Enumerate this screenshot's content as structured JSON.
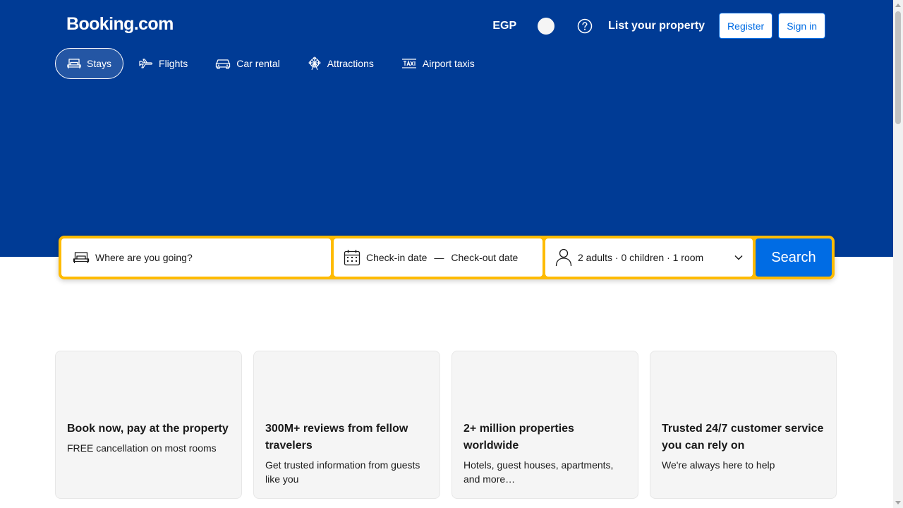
{
  "header": {
    "logo": "Booking.com",
    "currency": "EGP",
    "list_property": "List your property",
    "register": "Register",
    "sign_in": "Sign in"
  },
  "nav": {
    "tabs": [
      {
        "label": "Stays",
        "icon": "bed-icon",
        "active": true
      },
      {
        "label": "Flights",
        "icon": "plane-icon"
      },
      {
        "label": "Car rental",
        "icon": "car-icon"
      },
      {
        "label": "Attractions",
        "icon": "ferris-wheel-icon"
      },
      {
        "label": "Airport taxis",
        "icon": "taxi-icon"
      }
    ]
  },
  "search": {
    "destination_placeholder": "Where are you going?",
    "checkin": "Check-in date",
    "separator": "—",
    "checkout": "Check-out date",
    "guests": "2 adults · 0 children · 1 room",
    "button": "Search"
  },
  "cards": [
    {
      "title": "Book now, pay at the property",
      "text": "FREE cancellation on most rooms"
    },
    {
      "title": "300M+ reviews from fellow travelers",
      "text": "Get trusted information from guests like you"
    },
    {
      "title": "2+ million properties worldwide",
      "text": "Hotels, guest houses, apartments, and more…"
    },
    {
      "title": "Trusted 24/7 customer service you can rely on",
      "text": "We're always here to help"
    }
  ],
  "colors": {
    "brand_blue": "#003b95",
    "action_blue": "#006ce4",
    "search_yellow": "#febb02"
  }
}
